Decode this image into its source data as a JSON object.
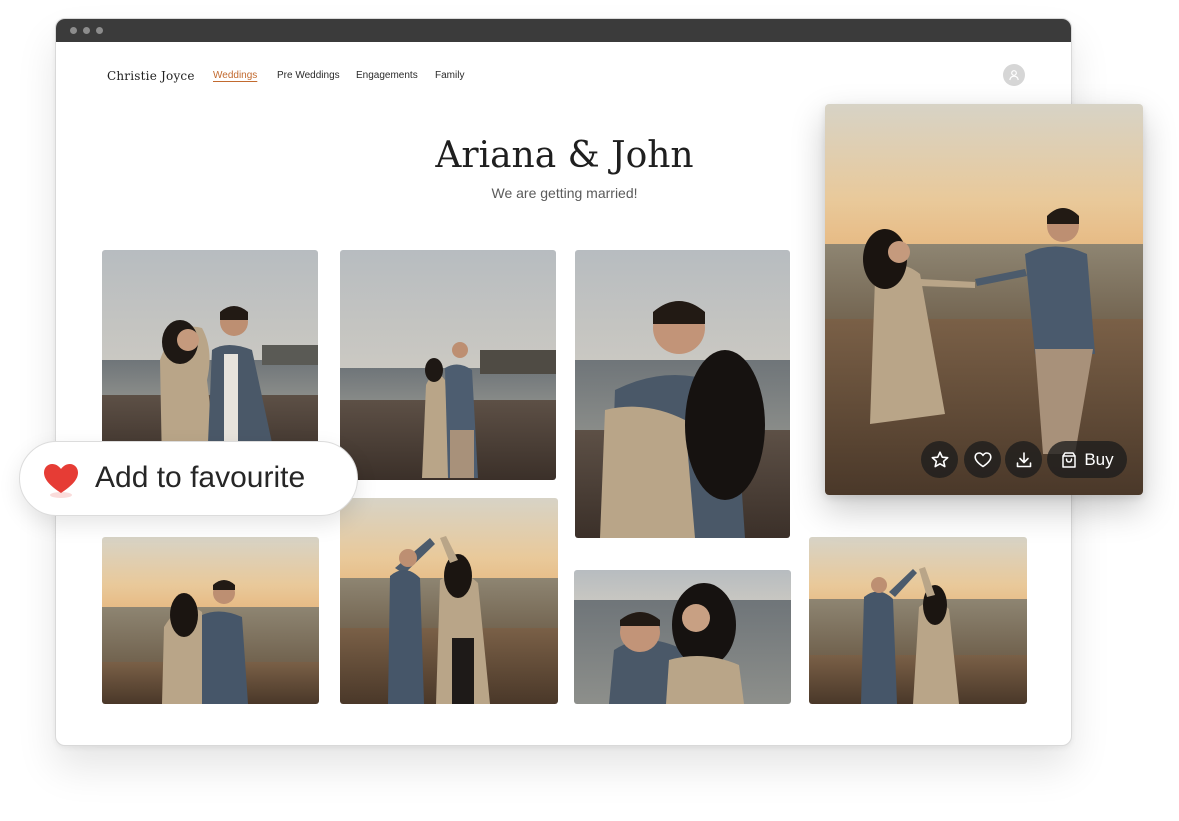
{
  "nav": {
    "brand": "Christie Joyce",
    "items": [
      {
        "label": "Weddings",
        "active": true
      },
      {
        "label": "Pre Weddings",
        "active": false
      },
      {
        "label": "Engagements",
        "active": false
      },
      {
        "label": "Family",
        "active": false
      }
    ],
    "avatar_icon": "user-icon"
  },
  "hero": {
    "title": "Ariana & John",
    "subtitle": "We are getting married!"
  },
  "gallery": {
    "photo_count": 8
  },
  "preview": {
    "actions": [
      {
        "icon": "star-icon"
      },
      {
        "icon": "heart-outline-icon"
      },
      {
        "icon": "download-icon"
      }
    ],
    "buy_label": "Buy",
    "buy_icon": "shopping-bag-icon"
  },
  "favourite": {
    "label": "Add to favourite",
    "icon": "heart-icon"
  },
  "colors": {
    "accent": "#c26a2f",
    "heart": "#e63c35",
    "titlebar": "#3b3b3b"
  }
}
